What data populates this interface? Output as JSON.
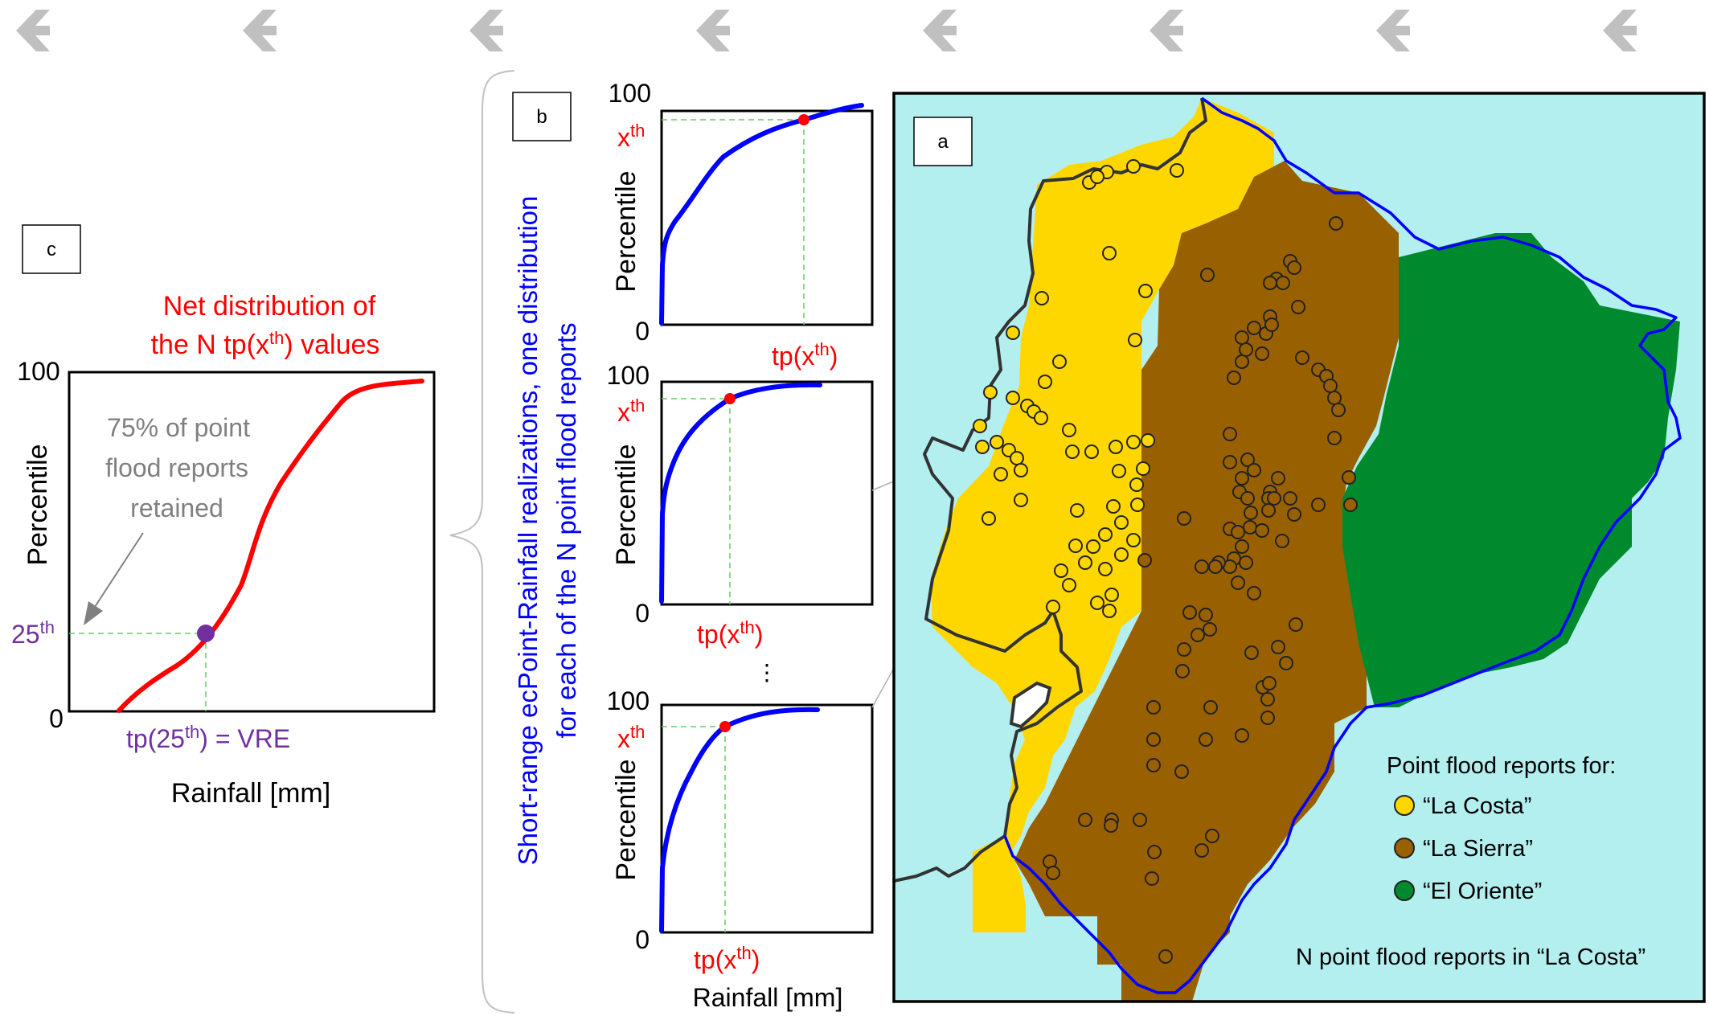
{
  "panel_labels": {
    "a": "a",
    "b": "b",
    "c": "c"
  },
  "panel_c": {
    "title_line1": "Net distribution of",
    "title_line2_pre": "the N tp(x",
    "title_sup": "th",
    "title_line2_post": ") values",
    "y_top": "100",
    "y_bottom": "0",
    "ylabel": "Percentile",
    "xlabel": "Rainfall [mm]",
    "annotation_line1": "75% of point",
    "annotation_line2": "flood reports",
    "annotation_line3": "retained",
    "pct_label": "25",
    "pct_sup": "th",
    "tp_label_pre": "tp(25",
    "tp_label_sup": "th",
    "tp_label_post": ") = VRE",
    "colors": {
      "curve": "#ff0000",
      "marker": "#7030a0",
      "annotation": "#808080"
    }
  },
  "panel_b": {
    "vertical_line1": "Short-range ecPoint-Rainfall realizations, one distribution",
    "vertical_line2": "for each of the N point flood reports",
    "y_top": "100",
    "y_bottom": "0",
    "ylabel": "Percentile",
    "xlabel": "Rainfall [mm]",
    "x_label": "x",
    "x_sup": "th",
    "tp_pre": "tp(x",
    "tp_sup": "th",
    "tp_post": ")",
    "ellipsis": "⋮",
    "colors": {
      "curve": "#0000ff",
      "marker": "#ff0000",
      "text": "#ff0000",
      "vertical_text": "#0000ff"
    }
  },
  "panel_a": {
    "legend_title": "Point flood reports for:",
    "legend_items": [
      {
        "label": "“La Costa”",
        "color": "#ffd700"
      },
      {
        "label": "“La Sierra”",
        "color": "#996000"
      },
      {
        "label": "“El Oriente”",
        "color": "#008a2e"
      }
    ],
    "footnote": "N point flood reports in “La Costa”",
    "colors": {
      "sea": "#b3efef",
      "costa": "#ffd700",
      "sierra": "#996000",
      "oriente": "#008a2e",
      "border": "#0000ff",
      "coast": "#333333"
    }
  }
}
